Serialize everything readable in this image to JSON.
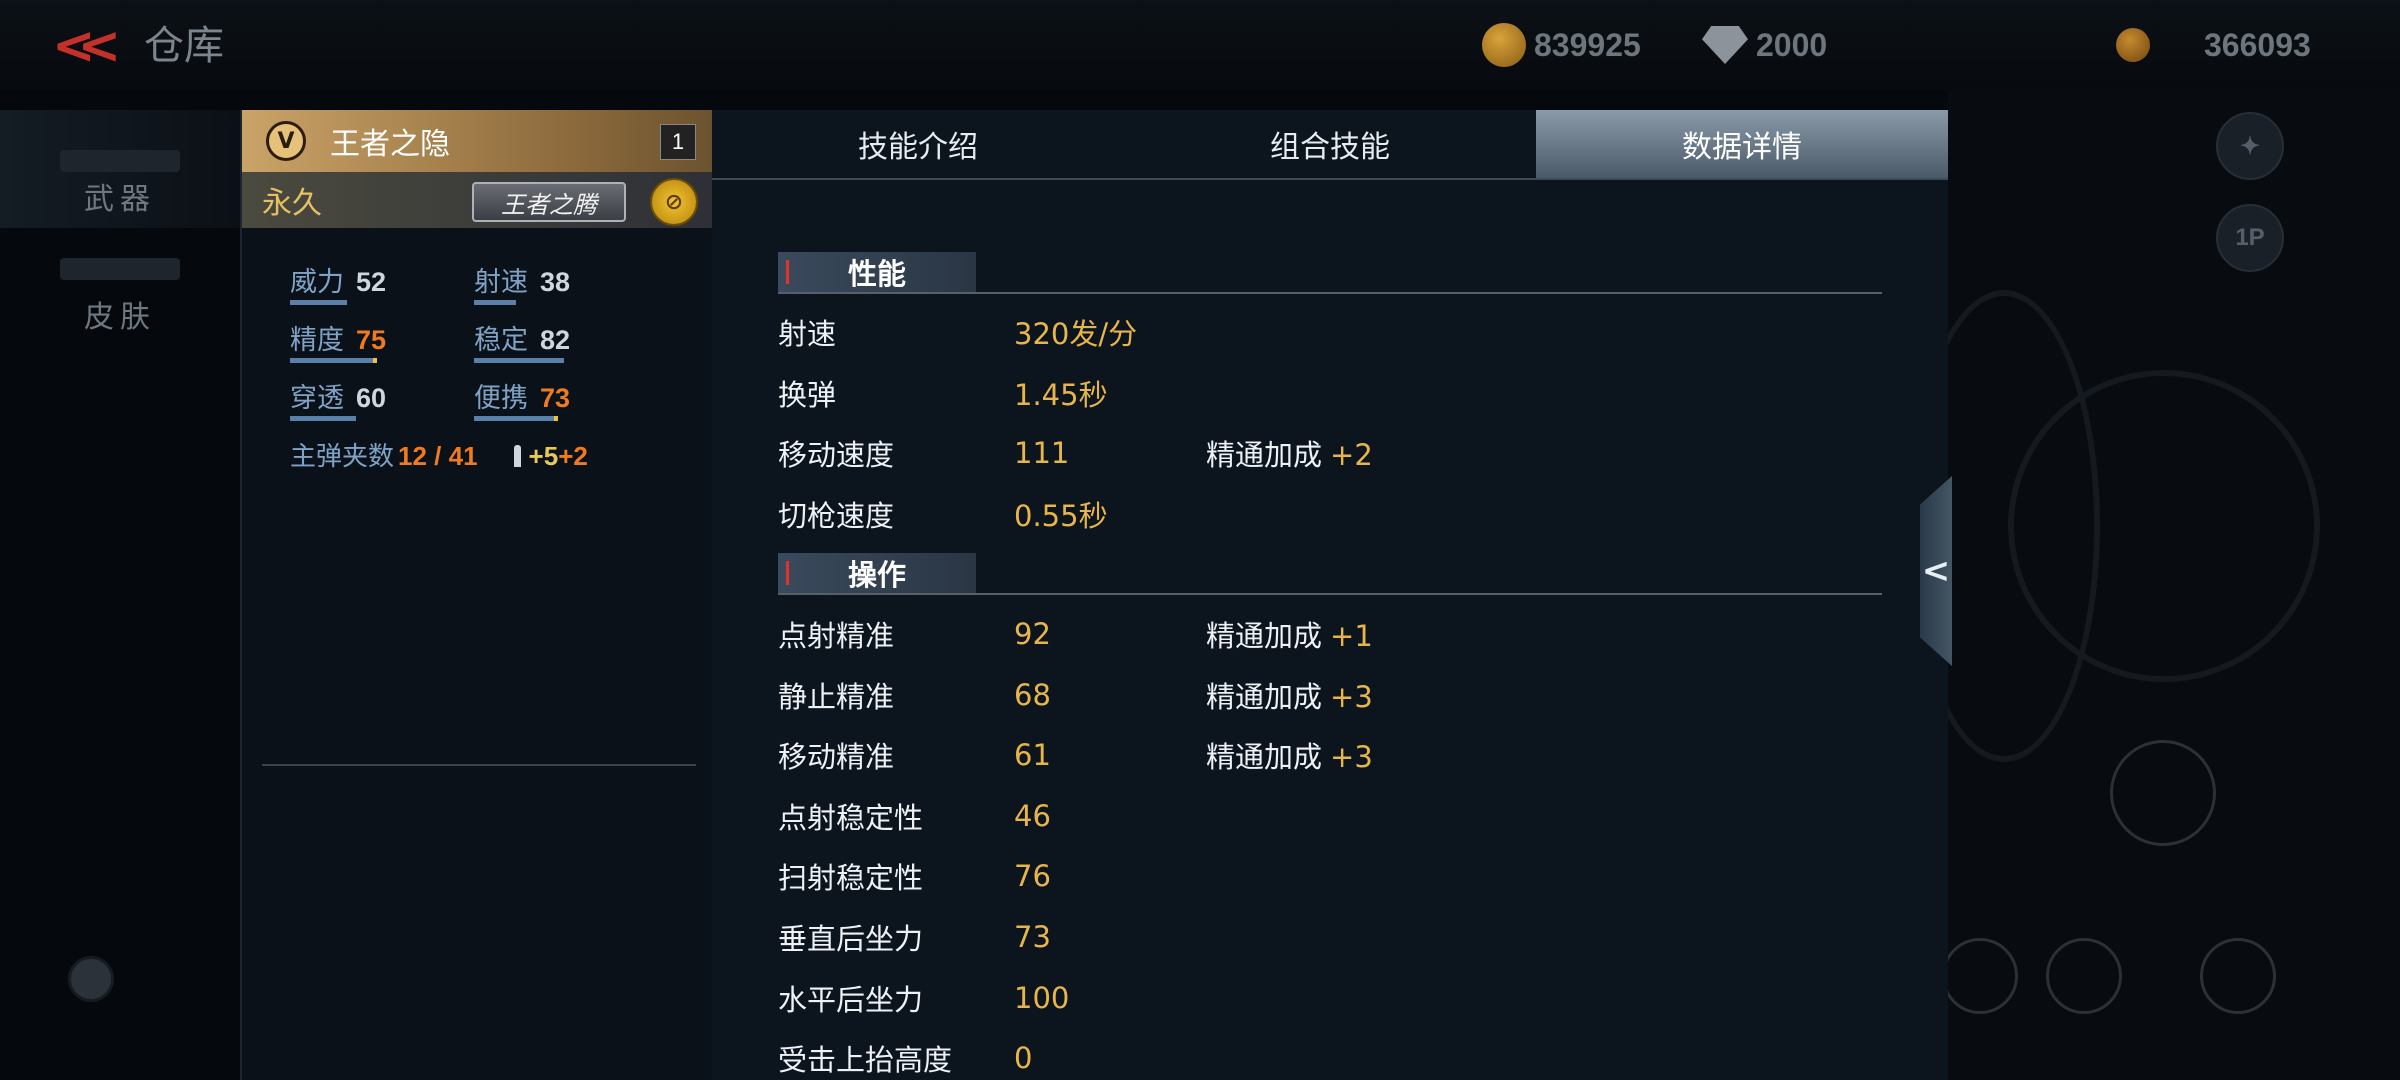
{
  "header": {
    "title": "仓库",
    "currencies": [
      {
        "icon": "gold-coin-icon",
        "value": "839925"
      },
      {
        "icon": "diamond-icon",
        "value": "2000"
      },
      {
        "icon": "token-icon",
        "value": "366093"
      }
    ]
  },
  "left_nav": [
    {
      "label": "武器",
      "active": true
    },
    {
      "label": "皮肤",
      "active": false
    }
  ],
  "side_buttons": {
    "perspective": "1P"
  },
  "weapon": {
    "name": "王者之隐",
    "count": "1",
    "duration": "永久",
    "badge": "王者之腾",
    "stats": [
      {
        "label": "威力",
        "value": "52",
        "highlight": false,
        "fraction": 0.52
      },
      {
        "label": "射速",
        "value": "38",
        "highlight": false,
        "fraction": 0.38
      },
      {
        "label": "精度",
        "value": "75",
        "highlight": true,
        "fraction": 0.75
      },
      {
        "label": "稳定",
        "value": "82",
        "highlight": false,
        "fraction": 0.82
      },
      {
        "label": "穿透",
        "value": "60",
        "highlight": false,
        "fraction": 0.6
      },
      {
        "label": "便携",
        "value": "73",
        "highlight": true,
        "fraction": 0.73
      }
    ],
    "ammo_label": "主弹夹数",
    "ammo_value": "12 / 41",
    "ammo_bonus_a": "+5",
    "ammo_bonus_b": "+2"
  },
  "tabs": [
    {
      "label": "技能介绍",
      "active": false
    },
    {
      "label": "组合技能",
      "active": false
    },
    {
      "label": "数据详情",
      "active": true
    }
  ],
  "sections": {
    "performance": {
      "title": "性能",
      "rows": [
        {
          "label": "射速",
          "value": "320发/分",
          "bonus_label": "",
          "bonus": ""
        },
        {
          "label": "换弹",
          "value": "1.45秒",
          "bonus_label": "",
          "bonus": ""
        },
        {
          "label": "移动速度",
          "value": "111",
          "bonus_label": "精通加成",
          "bonus": "+2"
        },
        {
          "label": "切枪速度",
          "value": "0.55秒",
          "bonus_label": "",
          "bonus": ""
        }
      ]
    },
    "operation": {
      "title": "操作",
      "rows": [
        {
          "label": "点射精准",
          "value": "92",
          "bonus_label": "精通加成",
          "bonus": "+1"
        },
        {
          "label": "静止精准",
          "value": "68",
          "bonus_label": "精通加成",
          "bonus": "+3"
        },
        {
          "label": "移动精准",
          "value": "61",
          "bonus_label": "精通加成",
          "bonus": "+3"
        },
        {
          "label": "点射稳定性",
          "value": "46",
          "bonus_label": "",
          "bonus": ""
        },
        {
          "label": "扫射稳定性",
          "value": "76",
          "bonus_label": "",
          "bonus": ""
        },
        {
          "label": "垂直后坐力",
          "value": "73",
          "bonus_label": "",
          "bonus": ""
        },
        {
          "label": "水平后坐力",
          "value": "100",
          "bonus_label": "",
          "bonus": ""
        },
        {
          "label": "受击上抬高度",
          "value": "0",
          "bonus_label": "",
          "bonus": ""
        }
      ]
    }
  },
  "colors": {
    "accent_gold": "#e8b54a",
    "highlight_orange": "#f07b1f",
    "red_mark": "#e0332b"
  }
}
